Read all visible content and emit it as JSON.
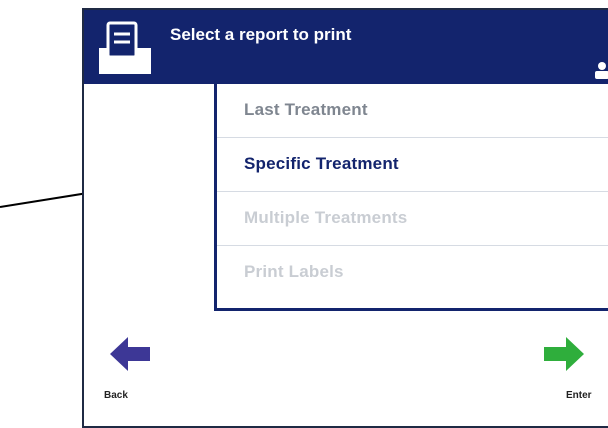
{
  "header": {
    "title": "Select a report to print"
  },
  "menu": {
    "items": [
      {
        "label": "Last Treatment",
        "state": "normal"
      },
      {
        "label": "Specific Treatment",
        "state": "selected"
      },
      {
        "label": "Multiple Treatments",
        "state": "disabled"
      },
      {
        "label": "Print Labels",
        "state": "disabled"
      }
    ]
  },
  "nav": {
    "back_label": "Back",
    "enter_label": "Enter",
    "back_icon": "arrow-left-icon",
    "enter_icon": "arrow-right-icon"
  },
  "colors": {
    "header": "#13246d",
    "back_arrow": "#3d3796",
    "enter_arrow": "#2fae3c"
  }
}
